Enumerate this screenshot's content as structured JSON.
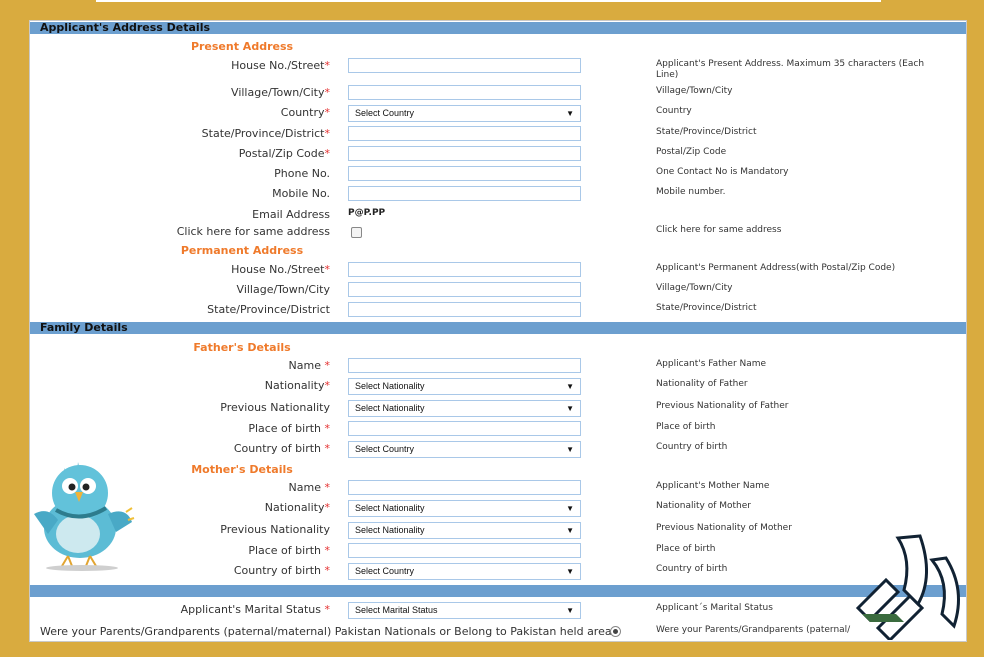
{
  "address_section": {
    "title": "Applicant's Address Details",
    "present_title": "Present Address",
    "permanent_title": "Permanent Address",
    "present": {
      "house": {
        "label": "House No./Street",
        "help": "Applicant's Present Address. Maximum 35 characters (Each Line)"
      },
      "village": {
        "label": "Village/Town/City",
        "help": "Village/Town/City"
      },
      "country": {
        "label": "Country",
        "value": "Select Country",
        "help": "Country"
      },
      "state": {
        "label": "State/Province/District",
        "help": "State/Province/District"
      },
      "postal": {
        "label": "Postal/Zip Code",
        "help": "Postal/Zip Code"
      },
      "phone": {
        "label": "Phone No.",
        "help": "One Contact No is Mandatory"
      },
      "mobile": {
        "label": "Mobile No.",
        "help": "Mobile number."
      },
      "email": {
        "label": "Email Address",
        "value": "P@P.PP"
      },
      "same": {
        "label": "Click here for same address",
        "help": "Click here for same address"
      }
    },
    "permanent": {
      "house": {
        "label": "House No./Street",
        "help": "Applicant's Permanent Address(with Postal/Zip Code)"
      },
      "village": {
        "label": "Village/Town/City",
        "help": "Village/Town/City"
      },
      "state": {
        "label": "State/Province/District",
        "help": "State/Province/District"
      }
    }
  },
  "family_section": {
    "title": "Family Details",
    "father_title": "Father's Details",
    "mother_title": "Mother's Details",
    "father": {
      "name": {
        "label": "Name ",
        "help": "Applicant's Father Name"
      },
      "nationality": {
        "label": "Nationality",
        "value": "Select Nationality",
        "help": "Nationality of Father"
      },
      "prev_nationality": {
        "label": "Previous Nationality",
        "value": "Select Nationality",
        "help": "Previous Nationality of Father"
      },
      "place_of_birth": {
        "label": "Place of birth ",
        "help": "Place of birth"
      },
      "country_of_birth": {
        "label": "Country of birth ",
        "value": "Select Country",
        "help": "Country of birth"
      }
    },
    "mother": {
      "name": {
        "label": "Name ",
        "help": "Applicant's Mother Name"
      },
      "nationality": {
        "label": "Nationality",
        "value": "Select Nationality",
        "help": "Nationality of Mother"
      },
      "prev_nationality": {
        "label": "Previous Nationality",
        "value": "Select Nationality",
        "help": "Previous Nationality of Mother"
      },
      "place_of_birth": {
        "label": "Place of birth ",
        "help": "Place of birth"
      },
      "country_of_birth": {
        "label": "Country of birth ",
        "value": "Select Country",
        "help": "Country of birth"
      }
    }
  },
  "marital": {
    "label": "Applicant's Marital Status ",
    "value": "Select Marital Status",
    "help": "Applicant´s Marital Status"
  },
  "parents_question": {
    "label": "Were your Parents/Grandparents (paternal/maternal) Pakistan Nationals or Belong to Pakistan held area.",
    "help": "Were your Parents/Grandparents (paternal/"
  },
  "required_mark": "*",
  "dropdown_arrow": "▼",
  "colors": {
    "section_bar": "#6c9fcf",
    "subheading": "#ef7a2b",
    "required": "#e53030",
    "background": "#d9ab3f"
  }
}
